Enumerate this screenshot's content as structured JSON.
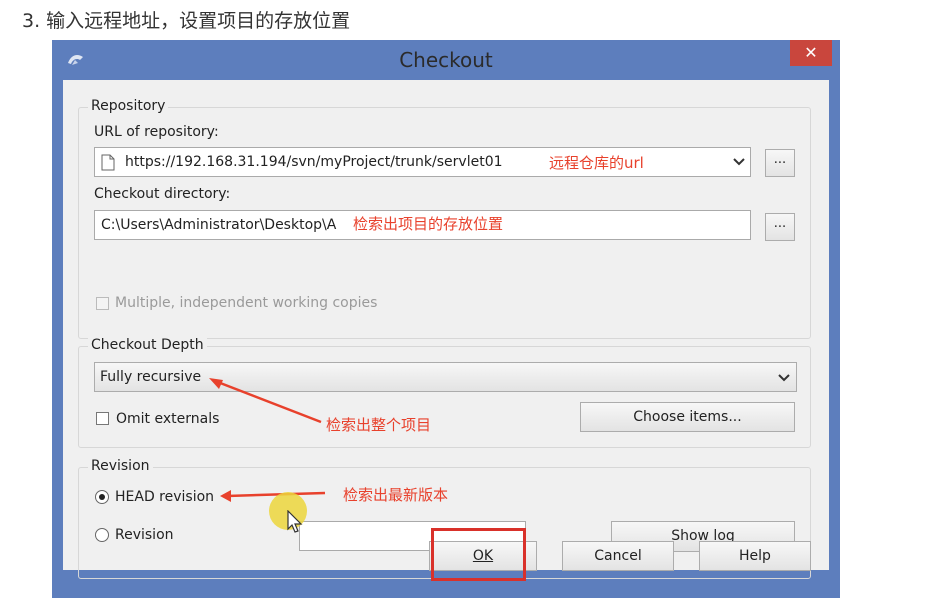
{
  "caption": "3. 输入远程地址，设置项目的存放位置",
  "dialog": {
    "title": "Checkout",
    "close_glyph": "✕",
    "repository": {
      "group_label": "Repository",
      "url_label": "URL of repository:",
      "url_value": "https://192.168.31.194/svn/myProject/trunk/servlet01",
      "url_annotation": "远程仓库的url",
      "browse_label": "...",
      "dir_label": "Checkout directory:",
      "dir_value": "C:\\Users\\Administrator\\Desktop\\A",
      "dir_annotation": "检索出项目的存放位置",
      "dir_browse_label": "...",
      "multiple_label": "Multiple, independent working copies"
    },
    "depth": {
      "group_label": "Checkout Depth",
      "selected": "Fully recursive",
      "omit_label": "Omit externals",
      "choose_label": "Choose items...",
      "annotation": "检索出整个项目"
    },
    "revision": {
      "group_label": "Revision",
      "head_label": "HEAD revision",
      "revision_label": "Revision",
      "head_annotation": "检索出最新版本",
      "show_log_label": "Show log"
    },
    "buttons": {
      "ok": "OK",
      "cancel": "Cancel",
      "help": "Help"
    },
    "colors": {
      "frame": "#5d7ebd",
      "close": "#c9463d",
      "annotation": "#e8412c",
      "highlight": "#d9312a"
    }
  }
}
